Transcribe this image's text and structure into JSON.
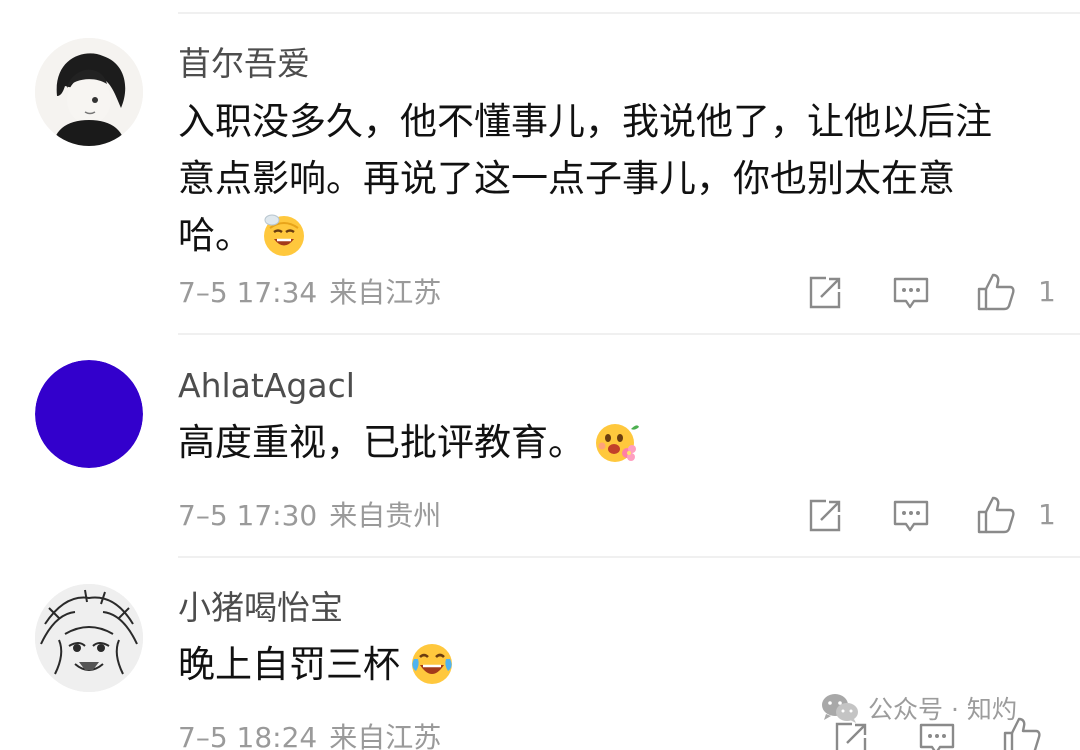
{
  "comments": [
    {
      "username": "苜尔吾爱",
      "content_lines": [
        "入职没多久，他不懂事儿，我说他了，让他以后注",
        "意点影响。再说了这一点子事儿，你也别太在意",
        "哈。"
      ],
      "emoji": "sweat-smile-emoji",
      "time": "7–5 17:34",
      "location": "来自江苏",
      "likes": "1"
    },
    {
      "username": "AhlatAgacl",
      "content_lines": [
        "高度重视，已批评教育。"
      ],
      "emoji": "flower-blush-emoji",
      "avatar_color": "#3300cc",
      "time": "7–5 17:30",
      "location": "来自贵州",
      "likes": "1"
    },
    {
      "username": "小猪喝怡宝",
      "content_lines": [
        "晚上自罚三杯"
      ],
      "emoji": "laugh-cry-emoji",
      "time": "7–5 18:24",
      "location": "来自江苏",
      "likes": ""
    }
  ],
  "icons": {
    "share": "share-icon",
    "reply": "comment-icon",
    "like": "thumbs-up-icon"
  },
  "watermark": {
    "text": "公众号 · 知灼"
  }
}
